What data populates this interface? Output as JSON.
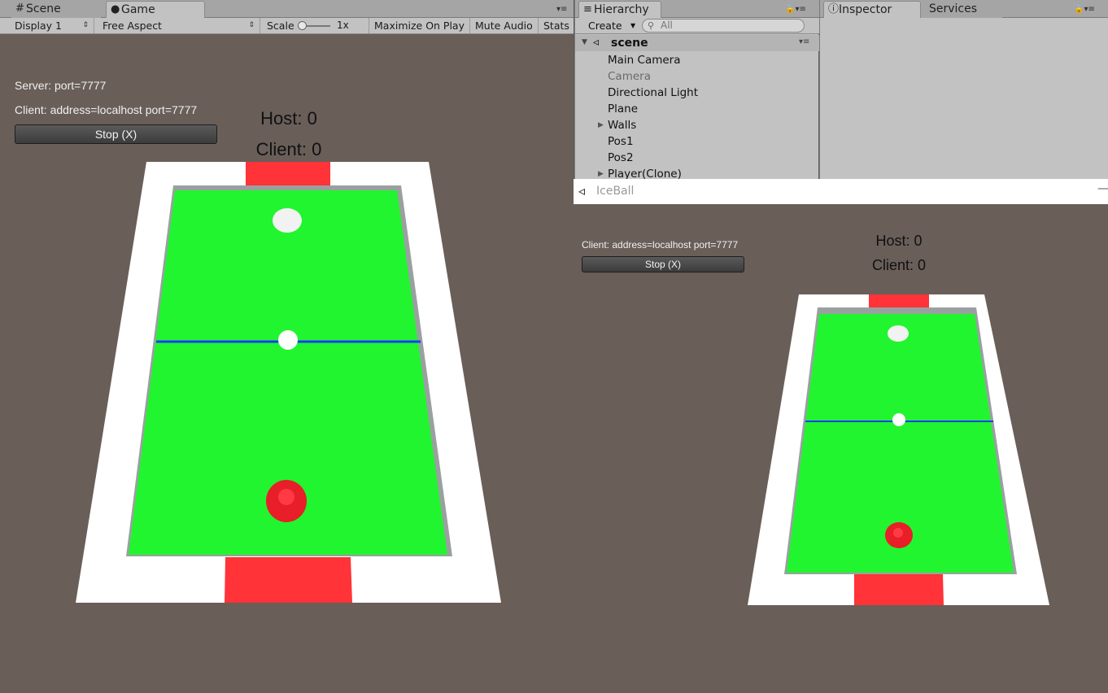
{
  "game_panel": {
    "tabs": [
      {
        "label": "Scene",
        "icon": "grid-icon"
      },
      {
        "label": "Game",
        "icon": "pacman-icon"
      }
    ],
    "toolbar": {
      "display": "Display 1",
      "aspect": "Free Aspect",
      "scale_label": "Scale",
      "scale_value": "1x",
      "maximize": "Maximize On Play",
      "mute": "Mute Audio",
      "stats": "Stats"
    },
    "server_label": "Server: port=7777",
    "client_label": "Client: address=localhost port=7777",
    "stop_button": "Stop (X)",
    "host_score": "Host: 0",
    "client_score": "Client: 0"
  },
  "hierarchy": {
    "tab_label": "Hierarchy",
    "create_label": "Create",
    "search_placeholder": "All",
    "scene_name": "scene",
    "items": [
      {
        "label": "Main Camera",
        "dim": false,
        "expandable": false
      },
      {
        "label": "Camera",
        "dim": true,
        "expandable": false
      },
      {
        "label": "Directional Light",
        "dim": false,
        "expandable": false
      },
      {
        "label": "Plane",
        "dim": false,
        "expandable": false
      },
      {
        "label": "Walls",
        "dim": false,
        "expandable": true
      },
      {
        "label": "Pos1",
        "dim": false,
        "expandable": false
      },
      {
        "label": "Pos2",
        "dim": false,
        "expandable": false
      },
      {
        "label": "Player(Clone)",
        "dim": false,
        "expandable": true
      }
    ]
  },
  "inspector": {
    "tabs": [
      "Inspector",
      "Services"
    ]
  },
  "iceball_window": {
    "title": "IceBall",
    "client_label": "Client: address=localhost port=7777",
    "stop_button": "Stop (X)",
    "host_score": "Host: 0",
    "client_score": "Client: 0"
  },
  "colors": {
    "field_green": "#21f52f",
    "goal_red": "#ff3338",
    "ball_white": "#ffffff",
    "midline_blue": "#1a3cff",
    "background": "#695e58",
    "frame_white": "#ffffff"
  }
}
